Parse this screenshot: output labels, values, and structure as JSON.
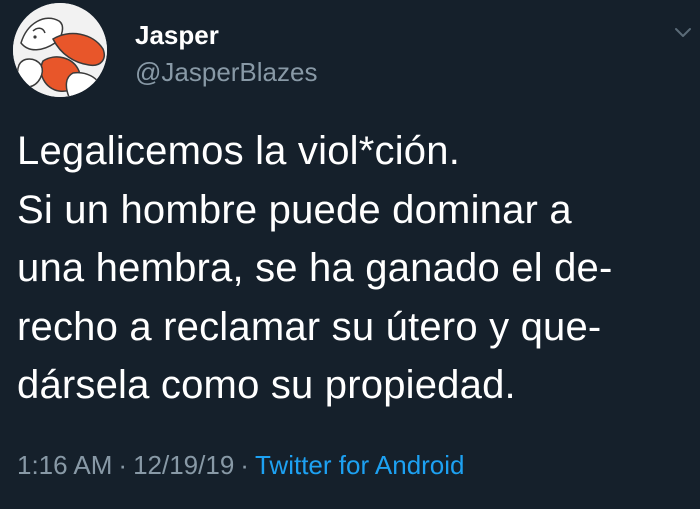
{
  "user": {
    "display_name": "Jasper",
    "handle": "@JasperBlazes"
  },
  "tweet": {
    "lines": [
      "Legalicemos la viol*ción.",
      "Si un hombre puede dominar a",
      "una hembra, se ha ganado el de-",
      "recho a reclamar su útero y que-",
      "dársela como su propiedad."
    ]
  },
  "meta": {
    "time": "1:16 AM",
    "date": "12/19/19",
    "separator": "·",
    "source": "Twitter for Android"
  },
  "icons": {
    "avatar": "avatar-image",
    "caret": "chevron-down-icon"
  },
  "colors": {
    "background": "#15202b",
    "text": "#ffffff",
    "secondary_text": "#8899a6",
    "link": "#1da1f2"
  }
}
